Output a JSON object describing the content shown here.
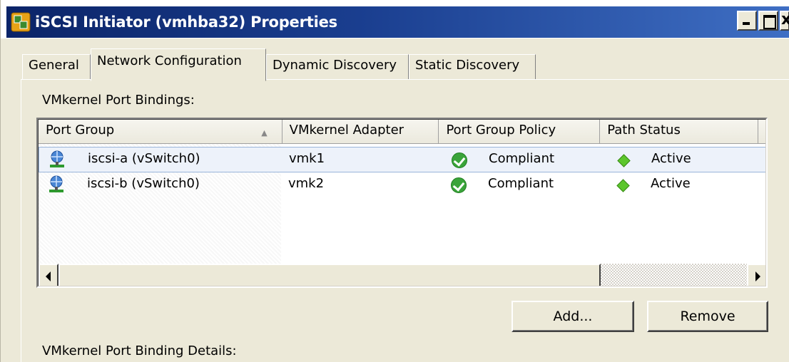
{
  "window": {
    "title": "iSCSI Initiator (vmhba32) Properties"
  },
  "tabs": [
    {
      "label": "General"
    },
    {
      "label": "Network Configuration"
    },
    {
      "label": "Dynamic Discovery"
    },
    {
      "label": "Static Discovery"
    }
  ],
  "active_tab": "Network Configuration",
  "section": {
    "bindings_label": "VMkernel Port Bindings:",
    "details_label": "VMkernel Port Binding Details:"
  },
  "table": {
    "columns": [
      "Port Group",
      "VMkernel Adapter",
      "Port Group Policy",
      "Path Status"
    ],
    "sort_icon": "sort-ascending-icon",
    "rows": [
      {
        "port_group": "iscsi-a (vSwitch0)",
        "adapter": "vmk1",
        "policy": "Compliant",
        "status": "Active",
        "selected": true
      },
      {
        "port_group": "iscsi-b (vSwitch0)",
        "adapter": "vmk2",
        "policy": "Compliant",
        "status": "Active",
        "selected": false
      }
    ]
  },
  "buttons": {
    "add": "Add...",
    "remove": "Remove"
  },
  "colors": {
    "titlebar_start": "#0b2468",
    "titlebar_end": "#3f6fc4",
    "selection_bg": "#edf2fa",
    "compliant_green": "#3aa43a",
    "active_green": "#5cc62c"
  }
}
